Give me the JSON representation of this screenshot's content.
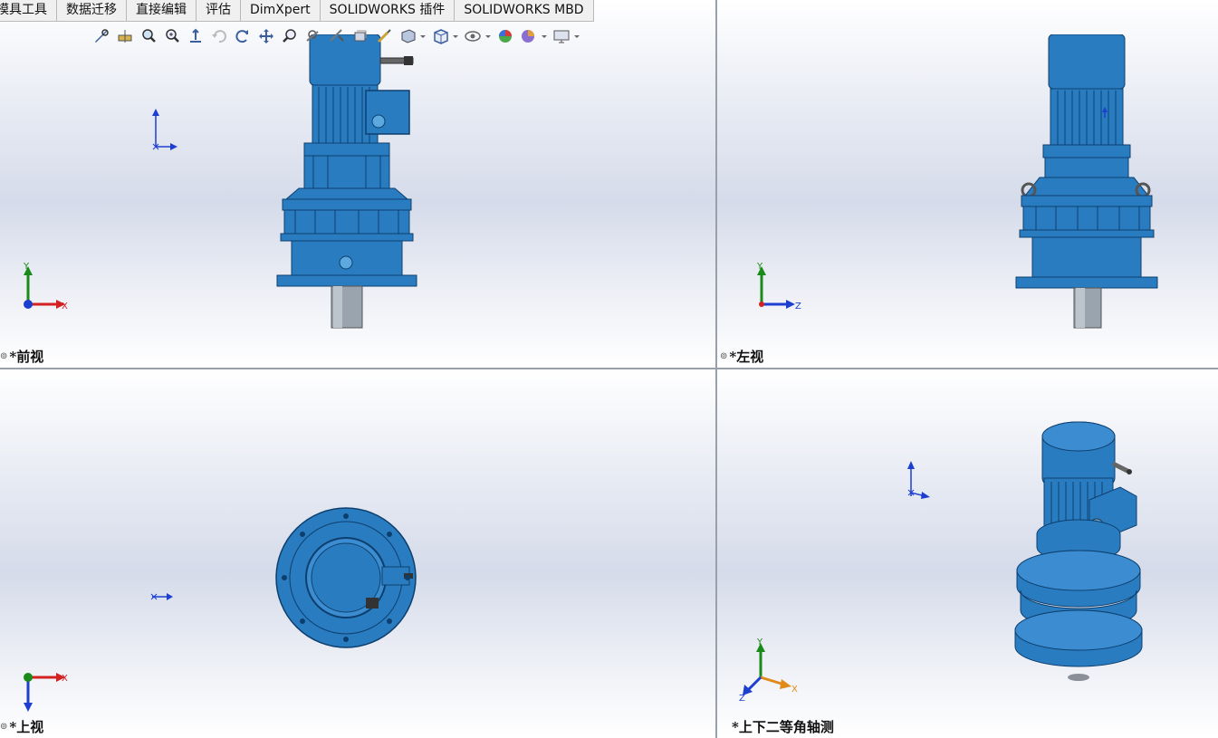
{
  "tabs": [
    "模具工具",
    "数据迁移",
    "直接编辑",
    "评估",
    "DimXpert",
    "SOLIDWORKS 插件",
    "SOLIDWORKS MBD"
  ],
  "toolbar_icons": [
    "zoom-to-fit-icon",
    "section-view-icon",
    "zoom-to-area-icon",
    "zoom-in-out-icon",
    "view-normal-icon",
    "undo-view-icon",
    "rotate-view-icon",
    "pan-icon",
    "zoom-select-icon",
    "previous-view-icon",
    "3d-drawing-view-icon",
    "sketch-icon",
    "view-orientation-icon",
    "display-style-icon",
    "hide-show-items-icon",
    "edit-appearance-icon",
    "apply-scene-icon",
    "view-settings-icon"
  ],
  "viewports": {
    "front": {
      "label": "*前视"
    },
    "left": {
      "label": "*左视"
    },
    "top": {
      "label": "*上视"
    },
    "iso": {
      "label": "*上下二等角轴测"
    }
  },
  "axes": {
    "x": "X",
    "y": "Y",
    "z": "Z"
  },
  "colors": {
    "model_blue": "#2a7cc0",
    "model_dark": "#0d3f6e",
    "axis_x": "#d32020",
    "axis_y": "#1a8a1a",
    "axis_z": "#1d3fd0",
    "axis_iso_x": "#e08a1a"
  }
}
